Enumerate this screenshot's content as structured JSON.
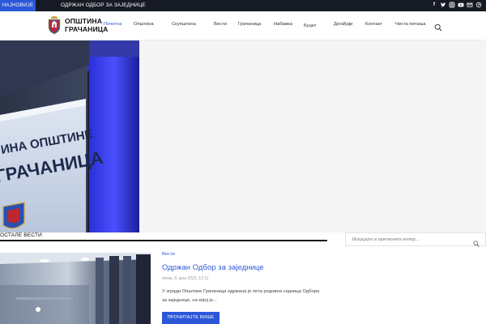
{
  "ticker": {
    "badge": "НАЈНОВИЈЕ",
    "headline": "ОДРЖАН ОДБОР ЗА ЗАЈЕДНИЦЕ",
    "social_icons": [
      "facebook-icon",
      "twitter-icon",
      "instagram-icon",
      "youtube-icon",
      "email-icon",
      "external-link-icon"
    ]
  },
  "header": {
    "logo_line1": "ОПШТИНА",
    "logo_line2": "ГРАЧАНИЦА",
    "nav": [
      {
        "label": "Почетна",
        "active": true
      },
      {
        "label": "Општина"
      },
      {
        "label": "Скупштина"
      },
      {
        "label": "Вести"
      },
      {
        "label": "Грачаница"
      },
      {
        "label": "Набавка"
      },
      {
        "label": "Буџет"
      },
      {
        "label": "Догађаји"
      },
      {
        "label": "Контакт"
      },
      {
        "label": "Честа питања"
      }
    ]
  },
  "hero": {
    "sign_line1": "ИНА ОПШТИНЕ",
    "sign_line2": "ГРАЧАНИЦА"
  },
  "section": {
    "title": "ОСТАЛЕ ВЕСТИ"
  },
  "sidebar": {
    "search_placeholder": "Искуцајте и притисните ентер..."
  },
  "article": {
    "category": "Вести",
    "title": "Одржан Одбор за заједнице",
    "meta": "петак, 9. јуна 2023. 12:11",
    "excerpt": "У згради Општине Грачаница одржана је пета редовна седница Одбора за заједнице, на којој је...",
    "read_more": "ПРОЧИТАЈТЕ ВИШЕ"
  },
  "colors": {
    "accent": "#2d57d9",
    "topbar": "#161a24"
  }
}
